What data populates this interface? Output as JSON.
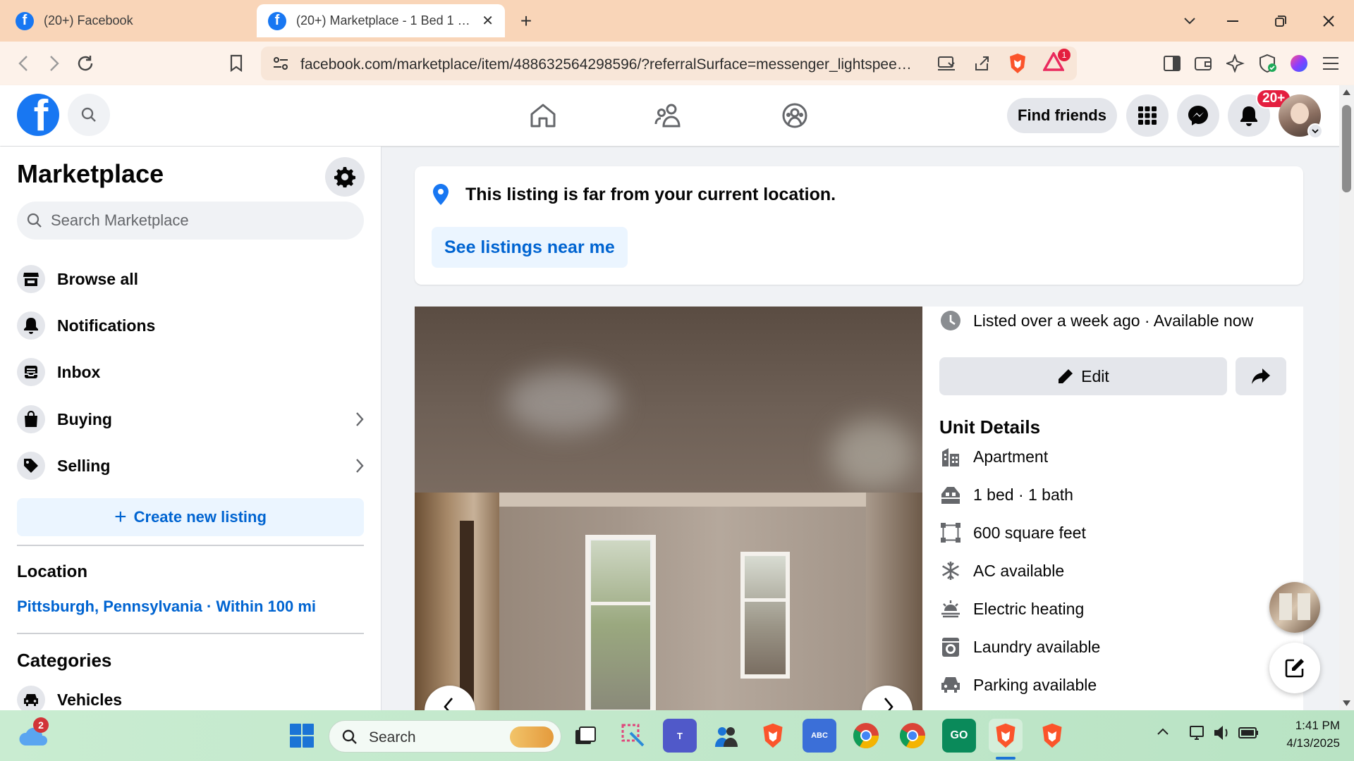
{
  "browser": {
    "tabs": [
      {
        "title": "(20+) Facebook",
        "active": false
      },
      {
        "title": "(20+) Marketplace - 1 Bed 1 Ba",
        "active": true
      }
    ],
    "new_tab_symbol": "+",
    "url": "facebook.com/marketplace/item/488632564298596/?referralSurface=messenger_lightspeed_...",
    "extension_badge": "1"
  },
  "header": {
    "find_friends_label": "Find friends",
    "notification_badge": "20+"
  },
  "sidebar": {
    "title": "Marketplace",
    "search_placeholder": "Search Marketplace",
    "items": [
      {
        "label": "Browse all",
        "icon": "storefront-icon"
      },
      {
        "label": "Notifications",
        "icon": "bell-icon"
      },
      {
        "label": "Inbox",
        "icon": "inbox-icon"
      },
      {
        "label": "Buying",
        "icon": "shopping-bag-icon"
      },
      {
        "label": "Selling",
        "icon": "price-tag-icon"
      }
    ],
    "create_listing_label": "Create new listing",
    "location_heading": "Location",
    "location_value": "Pittsburgh, Pennsylvania · Within 100 mi",
    "categories_heading": "Categories",
    "categories": [
      {
        "label": "Vehicles",
        "icon": "car-icon"
      }
    ]
  },
  "notice": {
    "message": "This listing is far from your current location.",
    "button_label": "See listings near me"
  },
  "listing": {
    "listed_text": "Listed over a week ago · Available now",
    "edit_label": "Edit",
    "unit_details_heading": "Unit Details",
    "details": [
      {
        "text": "Apartment",
        "icon": "building-icon"
      },
      {
        "text": "1 bed · 1 bath",
        "icon": "bed-icon"
      },
      {
        "text": "600 square feet",
        "icon": "square-feet-icon"
      },
      {
        "text": "AC available",
        "icon": "snowflake-icon"
      },
      {
        "text": "Electric heating",
        "icon": "heating-icon"
      },
      {
        "text": "Laundry available",
        "icon": "washer-icon"
      },
      {
        "text": "Parking available",
        "icon": "car-icon"
      }
    ]
  },
  "taskbar": {
    "weather_badge": "2",
    "search_placeholder": "Search",
    "time": "1:41 PM",
    "date": "4/13/2025"
  },
  "colors": {
    "facebook_blue": "#1877f2",
    "link_blue": "#0064d1",
    "badge_red": "#e41e3f",
    "tabstrip": "#f9d5b8"
  }
}
